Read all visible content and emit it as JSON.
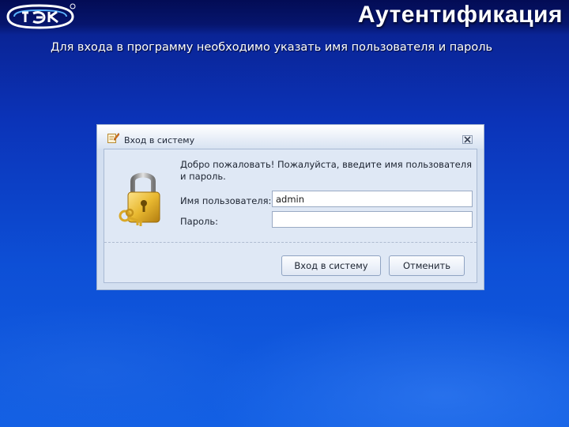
{
  "slide": {
    "title": "Аутентификация",
    "subtitle": "Для входа в программу необходимо указать имя пользователя и пароль"
  },
  "dialog": {
    "title": "Вход в систему",
    "welcome_text": "Добро пожаловать! Пожалуйста, введите имя пользователя и пароль.",
    "username_label": "Имя пользователя:",
    "username_value": "admin",
    "password_label": "Пароль:",
    "password_value": "",
    "login_button": "Вход в систему",
    "cancel_button": "Отменить"
  },
  "icons": {
    "logo": "company-logo",
    "title": "pencil-edit-icon",
    "close": "close-icon",
    "lock": "padlock-with-keys-icon"
  },
  "colors": {
    "background_top": "#0a1e88",
    "background_bottom": "#1360e4",
    "dialog_background": "#d3dff0",
    "panel_background": "#dfe8f5",
    "lock_gold": "#e8b830"
  }
}
